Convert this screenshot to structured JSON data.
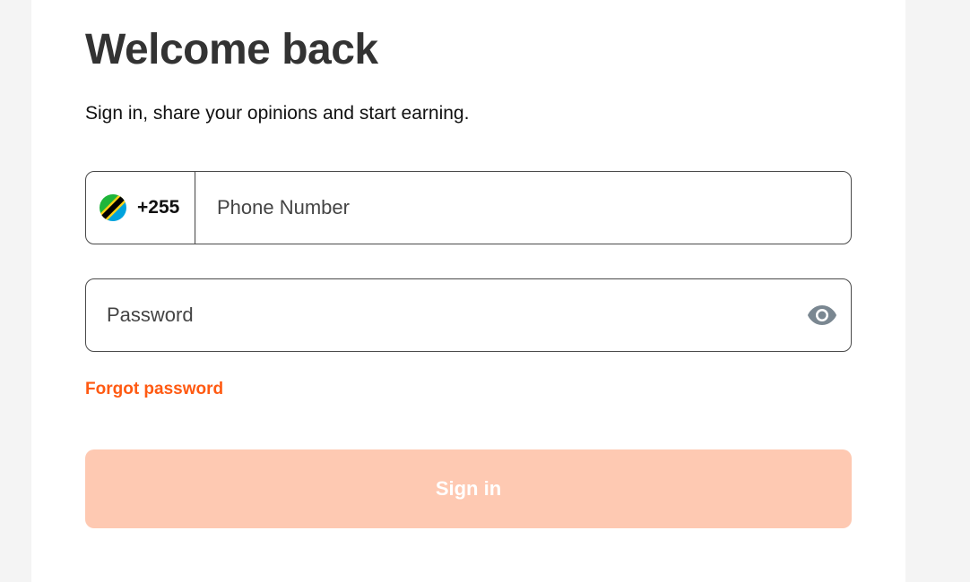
{
  "header": {
    "title": "Welcome back",
    "subtitle": "Sign in, share your opinions and start earning."
  },
  "phone": {
    "country_flag": "tanzania-flag",
    "dial_code": "+255",
    "value": "",
    "placeholder": "Phone Number"
  },
  "password": {
    "value": "",
    "placeholder": "Password",
    "toggle_icon": "eye-icon"
  },
  "links": {
    "forgot_password": "Forgot password"
  },
  "actions": {
    "sign_in_label": "Sign in"
  },
  "colors": {
    "accent": "#ff5a12",
    "button_disabled": "#fec9b2",
    "icon_gray": "#7a8791",
    "background": "#f4f4f4"
  }
}
